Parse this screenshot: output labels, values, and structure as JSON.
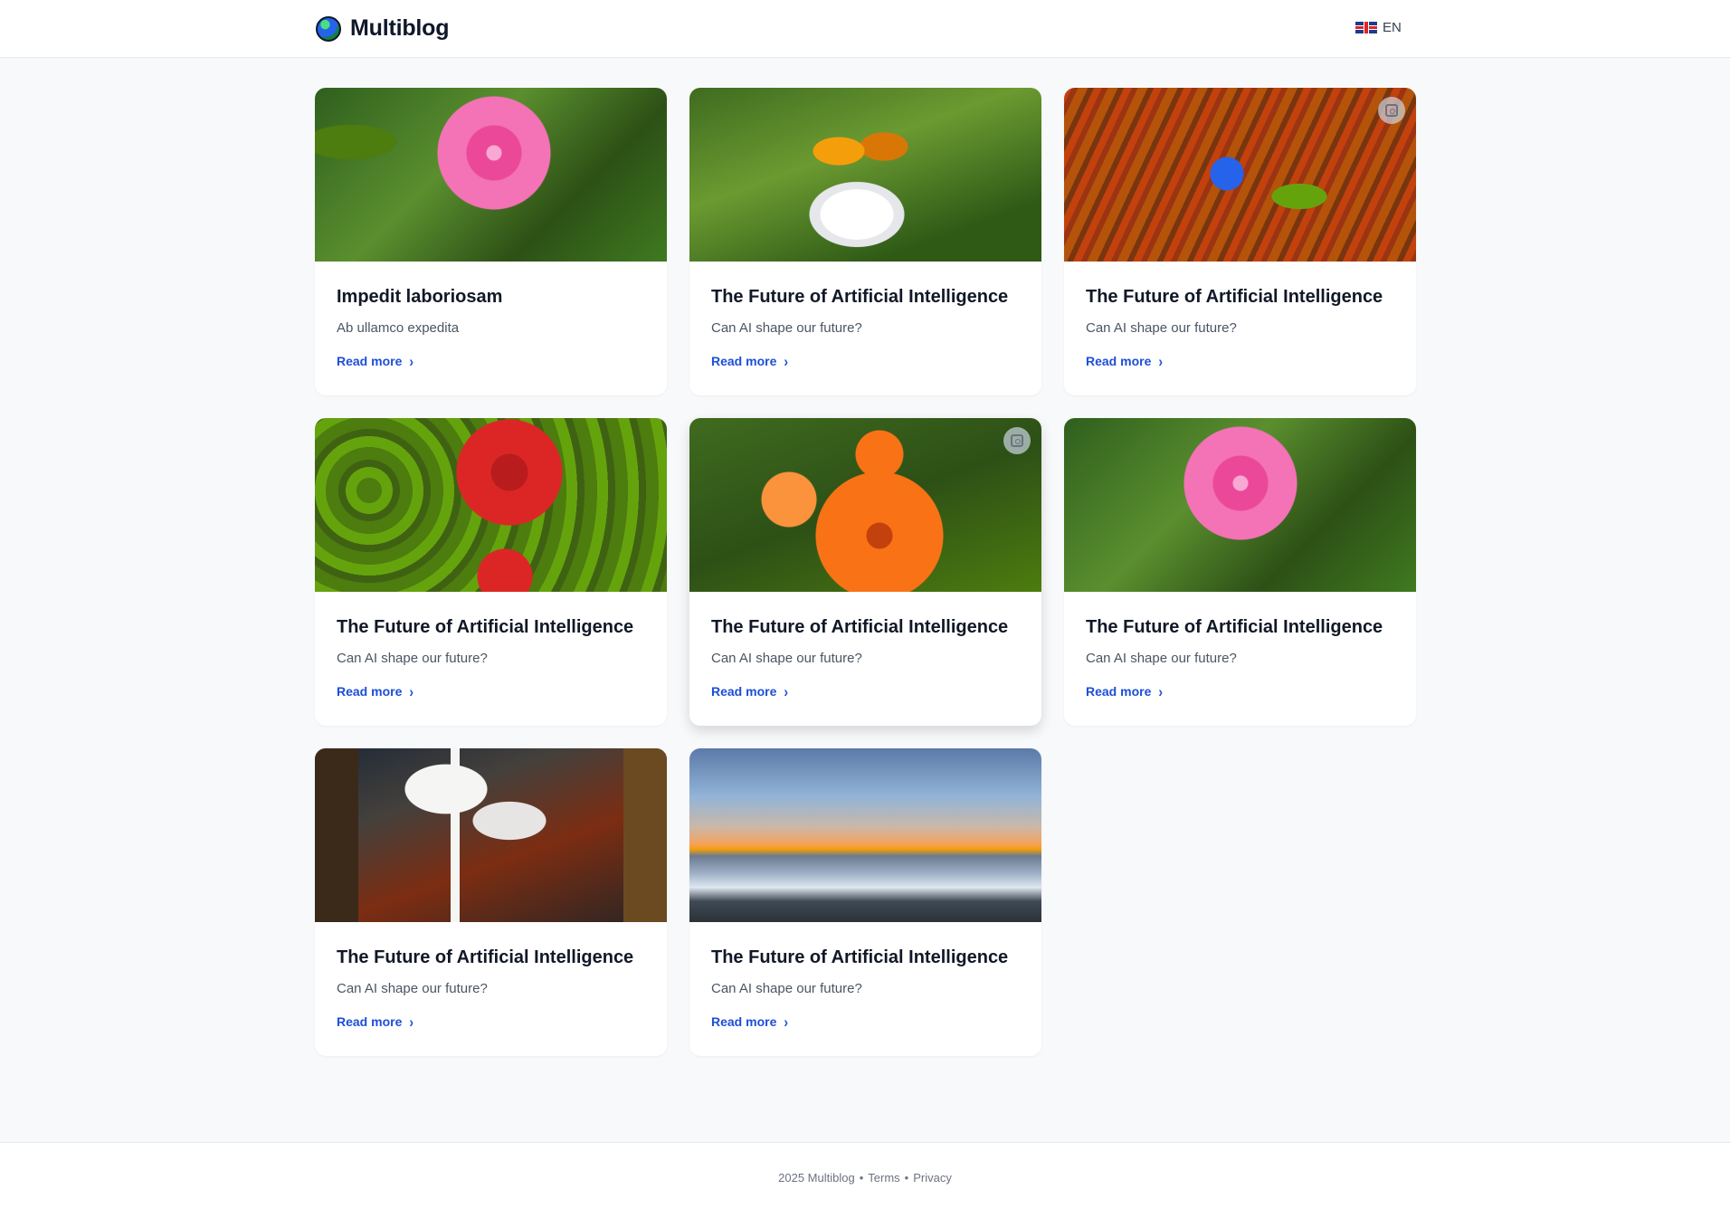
{
  "header": {
    "logo_text": "Multiblog",
    "language": {
      "code": "EN",
      "flag": "uk-flag-icon"
    }
  },
  "cards": [
    {
      "title": "Impedit laboriosam",
      "excerpt": "Ab ullamco expedita",
      "read_more": "Read more",
      "image": "pink-flower"
    },
    {
      "title": "The Future of Artificial Intelligence",
      "excerpt": "Can AI shape our future?",
      "read_more": "Read more",
      "image": "butterfly-on-white-flower"
    },
    {
      "title": "The Future of Artificial Intelligence",
      "excerpt": "Can AI shape our future?",
      "read_more": "Read more",
      "image": "blue-flower"
    },
    {
      "title": "The Future of Artificial Intelligence",
      "excerpt": "Can AI shape our future?",
      "read_more": "Read more",
      "image": "red-rose"
    },
    {
      "title": "The Future of Artificial Intelligence",
      "excerpt": "Can AI shape our future?",
      "read_more": "Read more",
      "image": "orange-marigold"
    },
    {
      "title": "The Future of Artificial Intelligence",
      "excerpt": "Can AI shape our future?",
      "read_more": "Read more",
      "image": "pink-flower"
    },
    {
      "title": "The Future of Artificial Intelligence",
      "excerpt": "Can AI shape our future?",
      "read_more": "Read more",
      "image": "mushrooms"
    },
    {
      "title": "The Future of Artificial Intelligence",
      "excerpt": "Can AI shape our future?",
      "read_more": "Read more",
      "image": "sea-sunset"
    }
  ],
  "footer": {
    "copyright": "2025 Multiblog",
    "separator": "•",
    "terms": "Terms",
    "privacy": "Privacy"
  },
  "colors": {
    "accent": "#1d4ed8",
    "background": "#f8f9fb",
    "card": "#ffffff"
  }
}
